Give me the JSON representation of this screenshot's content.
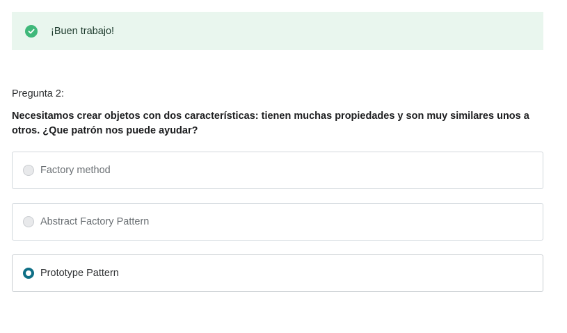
{
  "feedback": {
    "icon": "check-circle-icon",
    "message": "¡Buen trabajo!",
    "color": "#3fb87a",
    "background": "#e9f6ee"
  },
  "question": {
    "label": "Pregunta 2:",
    "text": "Necesitamos crear objetos con dos características: tienen muchas propiedades y son muy similares unos a otros. ¿Que patrón nos puede ayudar?"
  },
  "options": [
    {
      "label": "Factory method",
      "selected": false
    },
    {
      "label": "Abstract Factory Pattern",
      "selected": false
    },
    {
      "label": "Prototype Pattern",
      "selected": true
    }
  ],
  "colors": {
    "accent": "#0f6f86",
    "border": "#d1d7dc"
  }
}
